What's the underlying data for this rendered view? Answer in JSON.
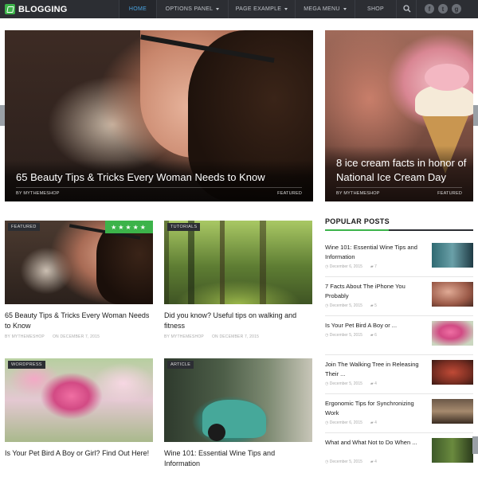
{
  "nav": {
    "logo": "BLOGGING",
    "items": [
      {
        "label": "HOME",
        "active": true
      },
      {
        "label": "OPTIONS PANEL",
        "caret": true
      },
      {
        "label": "PAGE EXAMPLE",
        "caret": true
      },
      {
        "label": "MEGA MENU",
        "caret": true
      },
      {
        "label": "SHOP"
      }
    ],
    "socials": [
      "f",
      "t",
      "g"
    ]
  },
  "hero": {
    "main": {
      "title": "65 Beauty Tips & Tricks Every Woman Needs to Know",
      "author": "BY MYTHEMESHOP",
      "category": "FEATURED"
    },
    "side": {
      "title": "8 ice cream facts in honor of National Ice Cream Day",
      "author": "BY MYTHEMESHOP",
      "category": "FEATURED"
    }
  },
  "cards": [
    {
      "badge": "FEATURED",
      "stars": "★★★★★",
      "title": "65 Beauty Tips & Tricks Every Woman Needs to Know",
      "author": "BY MYTHEMESHOP",
      "date": "ON DECEMBER 7, 2015"
    },
    {
      "badge": "TUTORIALS",
      "title": "Did you know? Useful tips on walking and fitness",
      "author": "BY MYTHEMESHOP",
      "date": "ON DECEMBER 7, 2015"
    },
    {
      "badge": "WORDPRESS",
      "title": "Is Your Pet Bird A Boy or Girl? Find Out Here!"
    },
    {
      "badge": "ARTICLE",
      "title": "Wine 101: Essential Wine Tips and Information"
    }
  ],
  "sidebar": {
    "heading": "POPULAR POSTS",
    "items": [
      {
        "title": "Wine 101: Essential Wine Tips and Information",
        "date": "December 6, 2015",
        "comments": "7"
      },
      {
        "title": "7 Facts About The iPhone You Probably",
        "date": "December 5, 2015",
        "comments": "5"
      },
      {
        "title": "Is Your Pet Bird A Boy or ...",
        "date": "December 5, 2015",
        "comments": "6"
      },
      {
        "title": "Join The Walking Tree in Releasing Their ...",
        "date": "December 5, 2015",
        "comments": "4"
      },
      {
        "title": "Ergonomic Tips for Synchronizing Work",
        "date": "December 6, 2015",
        "comments": "4"
      },
      {
        "title": "What and What Not to Do When ...",
        "date": "December 5, 2015",
        "comments": "4"
      }
    ]
  },
  "colors": {
    "nav_bg": "#2c2e33",
    "accent_green": "#3cb34a",
    "active_link": "#4aa3e0"
  }
}
